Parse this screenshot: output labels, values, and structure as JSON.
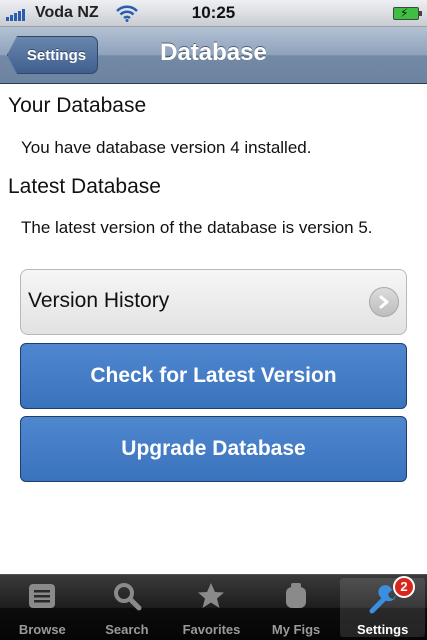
{
  "status_bar": {
    "carrier": "Voda NZ",
    "time": "10:25",
    "signal_icon": "signal-bars-icon",
    "wifi_icon": "wifi-icon",
    "battery_icon": "battery-charging-icon"
  },
  "nav": {
    "back_label": "Settings",
    "title": "Database"
  },
  "content": {
    "your_db_heading": "Your Database",
    "your_db_text": "You have database version 4 installed.",
    "latest_db_heading": "Latest Database",
    "latest_db_text": "The latest version of the database is version 5.",
    "version_history_label": "Version History",
    "check_button_label": "Check for Latest Version",
    "upgrade_button_label": "Upgrade Database"
  },
  "tabs": [
    {
      "label": "Browse",
      "icon": "list-icon",
      "active": false
    },
    {
      "label": "Search",
      "icon": "magnifier-icon",
      "active": false
    },
    {
      "label": "Favorites",
      "icon": "star-icon",
      "active": false
    },
    {
      "label": "My Figs",
      "icon": "figure-icon",
      "active": false
    },
    {
      "label": "Settings",
      "icon": "wrench-icon",
      "active": true,
      "badge": "2"
    }
  ],
  "colors": {
    "nav_bar": "#7389a5",
    "primary_button": "#3a73bd",
    "badge": "#d9261c"
  }
}
